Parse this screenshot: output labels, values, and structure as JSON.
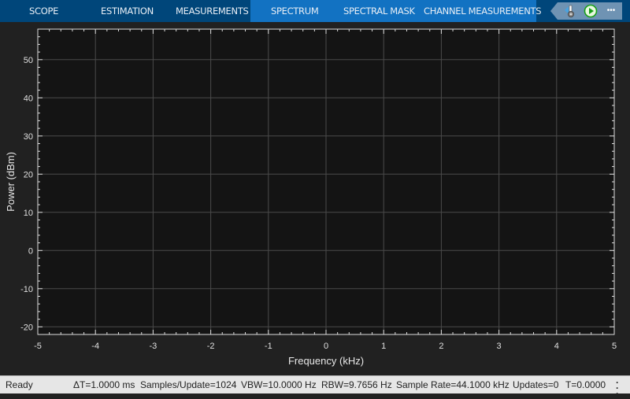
{
  "tabs": [
    {
      "label": "SCOPE"
    },
    {
      "label": "ESTIMATION"
    },
    {
      "label": "MEASUREMENTS"
    },
    {
      "label": "SPECTRUM"
    },
    {
      "label": "SPECTRAL MASK"
    },
    {
      "label": "CHANNEL MEASUREMENTS"
    }
  ],
  "toolbar": {
    "more_label": "•••"
  },
  "chart_data": {
    "type": "line",
    "series": [],
    "xlabel": "Frequency (kHz)",
    "ylabel": "Power (dBm)",
    "xlim": [
      -5,
      5
    ],
    "ylim": [
      -22,
      58
    ],
    "xticks": [
      "-5",
      "-4",
      "-3",
      "-2",
      "-1",
      "0",
      "1",
      "2",
      "3",
      "4",
      "5"
    ],
    "yticks": [
      "-20",
      "-10",
      "0",
      "10",
      "20",
      "30",
      "40",
      "50"
    ],
    "grid": true
  },
  "status": {
    "state": "Ready",
    "delta_t": "ΔT=1.0000 ms",
    "samples": "Samples/Update=1024",
    "vbw": "VBW=10.0000 Hz",
    "rbw": "RBW=9.7656 Hz",
    "rate": "Sample Rate=44.1000 kHz",
    "updates": "Updates=0",
    "t": "T=0.0000"
  },
  "colors": {
    "tabbar": "#00467a",
    "active": "#1272c2",
    "axes_bg": "#141414"
  }
}
